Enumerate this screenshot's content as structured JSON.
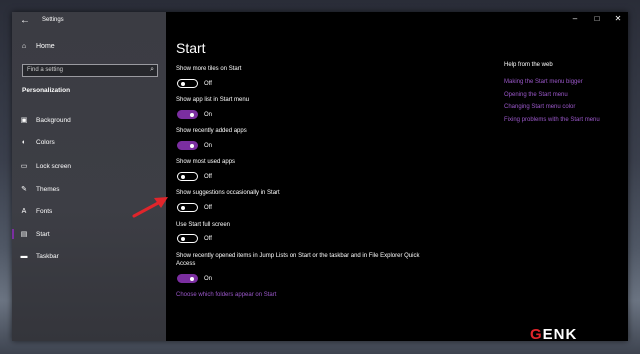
{
  "window": {
    "title": "Settings",
    "back_icon": "back-arrow-icon",
    "controls": [
      "minimize",
      "maximize",
      "close"
    ]
  },
  "sidebar": {
    "home_label": "Home",
    "search_placeholder": "Find a setting",
    "section": "Personalization",
    "items": [
      {
        "label": "Background",
        "icon": "picture-icon"
      },
      {
        "label": "Colors",
        "icon": "palette-icon"
      },
      {
        "label": "Lock screen",
        "icon": "lock-screen-icon"
      },
      {
        "label": "Themes",
        "icon": "brush-icon"
      },
      {
        "label": "Fonts",
        "icon": "font-icon"
      },
      {
        "label": "Start",
        "icon": "start-icon",
        "active": true
      },
      {
        "label": "Taskbar",
        "icon": "taskbar-icon"
      }
    ]
  },
  "main": {
    "title": "Start",
    "settings": [
      {
        "label": "Show more tiles on Start",
        "state": "Off"
      },
      {
        "label": "Show app list in Start menu",
        "state": "On"
      },
      {
        "label": "Show recently added apps",
        "state": "On"
      },
      {
        "label": "Show most used apps",
        "state": "Off"
      },
      {
        "label": "Show suggestions occasionally in Start",
        "state": "Off"
      },
      {
        "label": "Use Start full screen",
        "state": "Off"
      },
      {
        "label": "Show recently opened items in Jump Lists on Start or the taskbar and in File Explorer Quick Access",
        "state": "On"
      }
    ],
    "folders_link": "Choose which folders appear on Start"
  },
  "help": {
    "title": "Help from the web",
    "links": [
      "Making the Start menu bigger",
      "Opening the Start menu",
      "Changing Start menu color",
      "Fixing problems with the Start menu"
    ]
  },
  "watermark": {
    "g": "G",
    "rest": "ENK"
  },
  "colors": {
    "accent": "#7b2ea0",
    "link": "#9a57c9",
    "arrow": "#e0252b"
  }
}
